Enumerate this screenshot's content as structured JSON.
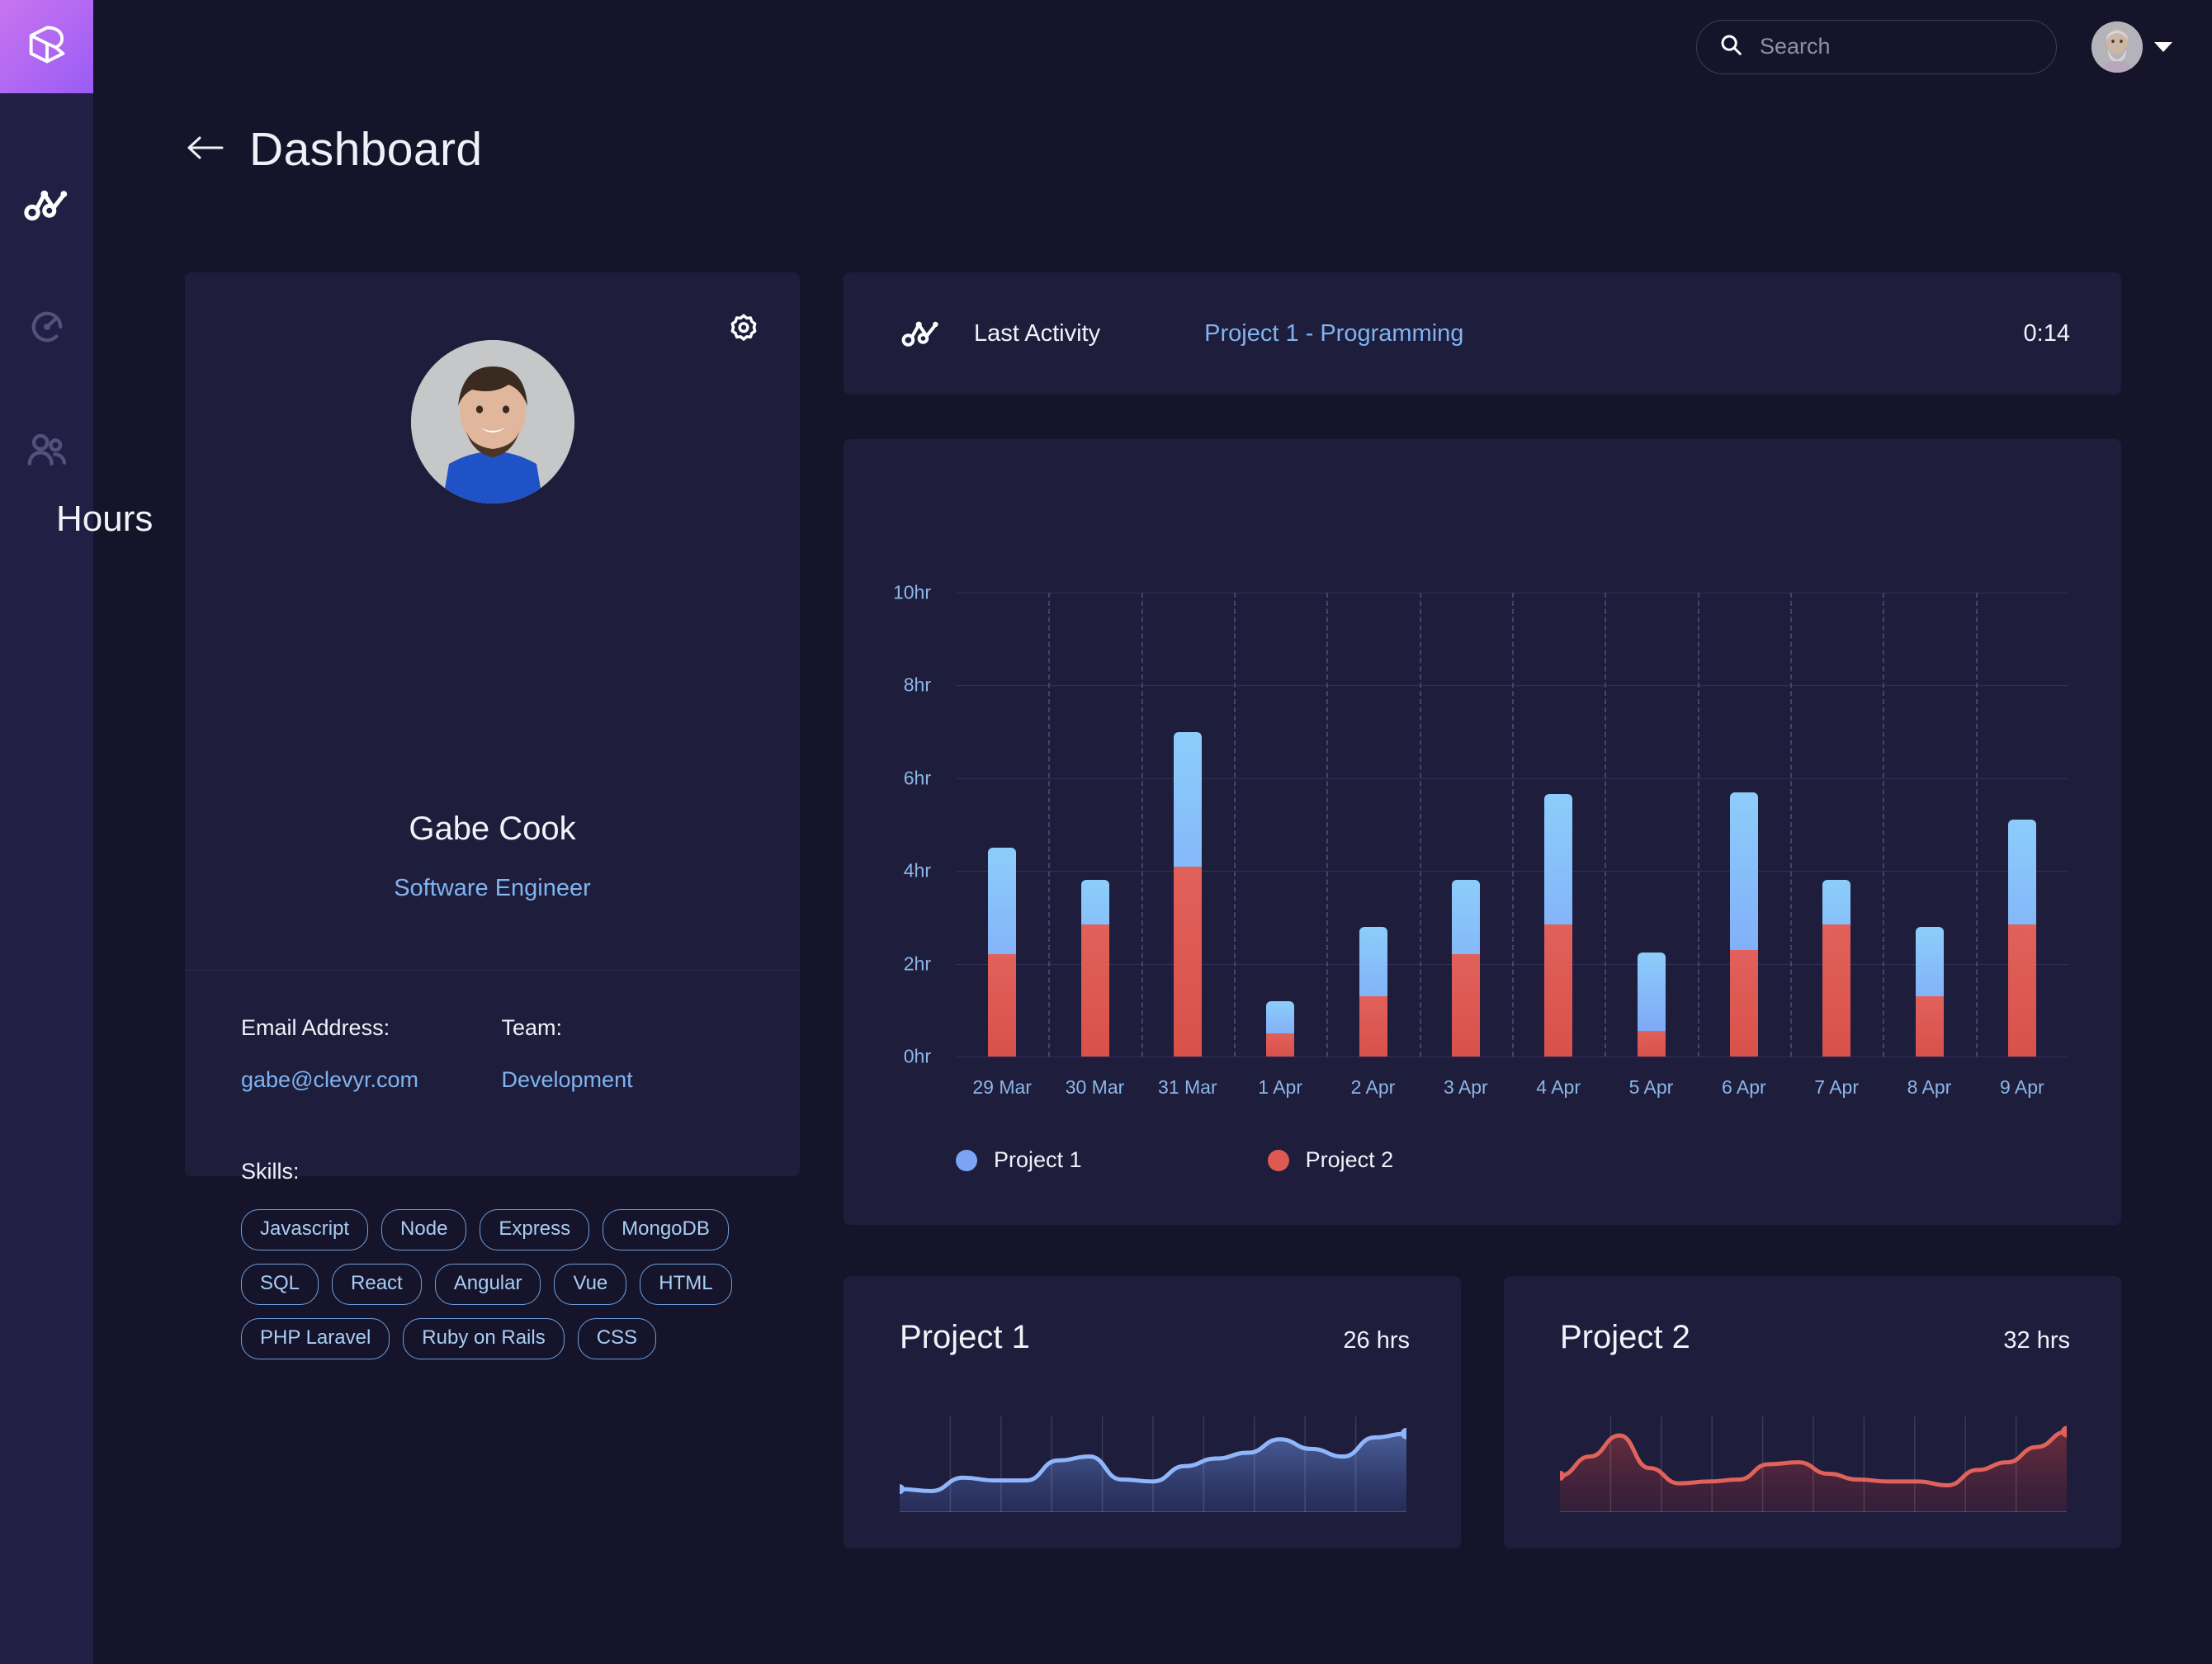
{
  "brand": {
    "logo_icon": "cube-logo-icon",
    "accent_start": "#c874f0",
    "accent_end": "#9a5cf5"
  },
  "sidebar": {
    "items": [
      {
        "icon": "activity-chart-icon",
        "name": "activity",
        "active": true
      },
      {
        "icon": "gauge-icon",
        "name": "timer",
        "active": false
      },
      {
        "icon": "people-icon",
        "name": "team",
        "active": false
      }
    ]
  },
  "topbar": {
    "search": {
      "placeholder": "Search",
      "value": "",
      "icon": "search-icon"
    },
    "avatar": {
      "icon": "avatar",
      "chevron": "chevron-down-icon"
    }
  },
  "header": {
    "back_icon": "arrow-left-icon",
    "title": "Dashboard"
  },
  "profile": {
    "settings_icon": "gear-icon",
    "name": "Gabe Cook",
    "role": "Software Engineer",
    "email_label": "Email Address:",
    "email_value": "gabe@clevyr.com",
    "team_label": "Team:",
    "team_value": "Development",
    "skills_label": "Skills:",
    "skills": [
      "Javascript",
      "Node",
      "Express",
      "MongoDB",
      "SQL",
      "React",
      "Angular",
      "Vue",
      "HTML",
      "PHP Laravel",
      "Ruby on Rails",
      "CSS"
    ]
  },
  "last_activity": {
    "icon": "activity-chart-icon",
    "label": "Last Activity",
    "project": "Project 1 - Programming",
    "time": "0:14"
  },
  "projects": [
    {
      "title": "Project 1",
      "hours": "26 hrs",
      "color": "#7da3f5"
    },
    {
      "title": "Project 2",
      "hours": "32 hrs",
      "color": "#dd5a52"
    }
  ],
  "chart_data": {
    "type": "bar",
    "title": "Hours",
    "stacked": true,
    "xlabel": "",
    "ylabel": "",
    "ylim": [
      0,
      10
    ],
    "ytick_labels": [
      "0hr",
      "2hr",
      "4hr",
      "6hr",
      "8hr",
      "10hr"
    ],
    "ytick_values": [
      0,
      2,
      4,
      6,
      8,
      10
    ],
    "grid": {
      "horizontal": true,
      "vertical_dashed": true
    },
    "legend_position": "bottom-left",
    "categories": [
      "29 Mar",
      "30 Mar",
      "31 Mar",
      "1 Apr",
      "2 Apr",
      "3 Apr",
      "4 Apr",
      "5 Apr",
      "6 Apr",
      "7 Apr",
      "8 Apr",
      "9 Apr"
    ],
    "series": [
      {
        "name": "Project 2",
        "color": "#dd5a52",
        "values": [
          2.2,
          2.85,
          4.1,
          0.5,
          1.3,
          2.2,
          2.85,
          0.55,
          2.3,
          2.85,
          1.3,
          2.85
        ]
      },
      {
        "name": "Project 1",
        "color": "#7da3f5",
        "values": [
          2.3,
          0.95,
          2.9,
          0.7,
          1.5,
          1.6,
          2.8,
          1.7,
          3.4,
          0.95,
          1.5,
          2.25
        ]
      }
    ],
    "totals": [
      4.5,
      3.8,
      7.0,
      1.2,
      2.8,
      3.8,
      5.65,
      2.25,
      5.7,
      3.8,
      2.8,
      5.1
    ],
    "sparklines": [
      {
        "name": "Project 1",
        "values": [
          0.18,
          0.16,
          0.3,
          0.27,
          0.27,
          0.48,
          0.52,
          0.28,
          0.26,
          0.42,
          0.5,
          0.56,
          0.7,
          0.6,
          0.52,
          0.72,
          0.76
        ]
      },
      {
        "name": "Project 2",
        "values": [
          0.32,
          0.52,
          0.74,
          0.4,
          0.24,
          0.26,
          0.28,
          0.44,
          0.46,
          0.34,
          0.28,
          0.26,
          0.26,
          0.22,
          0.38,
          0.46,
          0.62,
          0.78
        ]
      }
    ]
  }
}
